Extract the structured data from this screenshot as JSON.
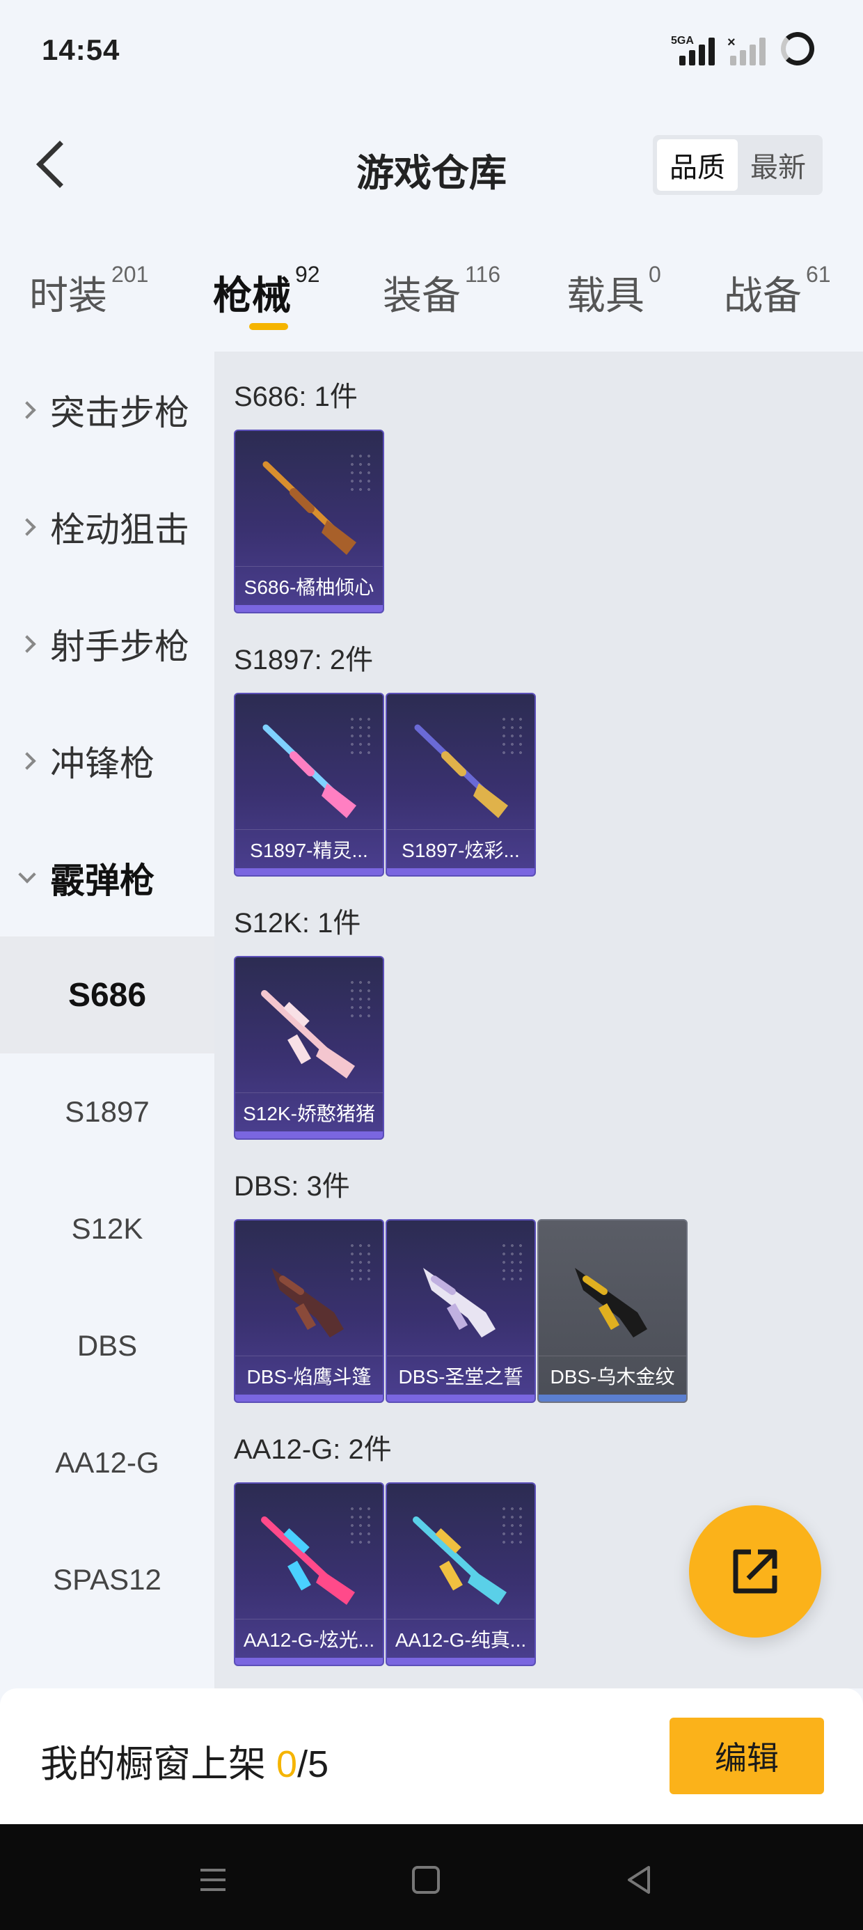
{
  "status_bar": {
    "time": "14:54",
    "network_label": "5GA"
  },
  "header": {
    "title": "游戏仓库",
    "sort_options": [
      {
        "label": "品质",
        "active": true
      },
      {
        "label": "最新",
        "active": false
      }
    ]
  },
  "tabs": [
    {
      "label": "时装",
      "count": "201",
      "active": false
    },
    {
      "label": "枪械",
      "count": "92",
      "active": true
    },
    {
      "label": "装备",
      "count": "116",
      "active": false
    },
    {
      "label": "载具",
      "count": "0",
      "active": false
    },
    {
      "label": "战备",
      "count": "61",
      "active": false
    }
  ],
  "sidebar": {
    "categories": [
      "突击步枪",
      "栓动狙击",
      "射手步枪",
      "冲锋枪",
      "霰弹枪"
    ],
    "open_category": "霰弹枪",
    "subitems": [
      "S686",
      "S1897",
      "S12K",
      "DBS",
      "AA12-G",
      "SPAS12"
    ],
    "active_subitem": "S686"
  },
  "groups": [
    {
      "title": "S686: 1件",
      "items": [
        {
          "name": "S686-橘柚倾心",
          "icon": "shotgun-icon",
          "color": "#d98f2e",
          "accent": "#a8602a"
        }
      ]
    },
    {
      "title": "S1897: 2件",
      "items": [
        {
          "name": "S1897-精灵...",
          "icon": "shotgun-icon",
          "color": "#7fd1ff",
          "accent": "#ff7fc2"
        },
        {
          "name": "S1897-炫彩...",
          "icon": "shotgun-icon",
          "color": "#6a6ad6",
          "accent": "#e0b24a"
        }
      ]
    },
    {
      "title": "S12K: 1件",
      "items": [
        {
          "name": "S12K-娇憨猪猪",
          "icon": "rifle-icon",
          "color": "#f4c6cf",
          "accent": "#f8e0e6"
        }
      ]
    },
    {
      "title": "DBS: 3件",
      "items": [
        {
          "name": "DBS-焰鹰斗篷",
          "icon": "dbs-icon",
          "color": "#5a3030",
          "accent": "#8a4a3a"
        },
        {
          "name": "DBS-圣堂之誓",
          "icon": "dbs-icon",
          "color": "#e8e4f2",
          "accent": "#c0b0e0"
        },
        {
          "name": "DBS-乌木金纹",
          "icon": "dbs-icon",
          "color": "#1a1a1a",
          "accent": "#e0b020"
        }
      ]
    },
    {
      "title": "AA12-G: 2件",
      "items": [
        {
          "name": "AA12-G-炫光...",
          "icon": "rifle-icon",
          "color": "#ff4a8a",
          "accent": "#4ad0ff"
        },
        {
          "name": "AA12-G-纯真...",
          "icon": "rifle-icon",
          "color": "#5ad0e8",
          "accent": "#f0c040"
        }
      ]
    }
  ],
  "bottom_bar": {
    "label": "我的橱窗上架",
    "current": "0",
    "total": "/5",
    "edit_label": "编辑"
  },
  "colors": {
    "accent": "#fbb21a",
    "highlight": "#f5b400"
  }
}
